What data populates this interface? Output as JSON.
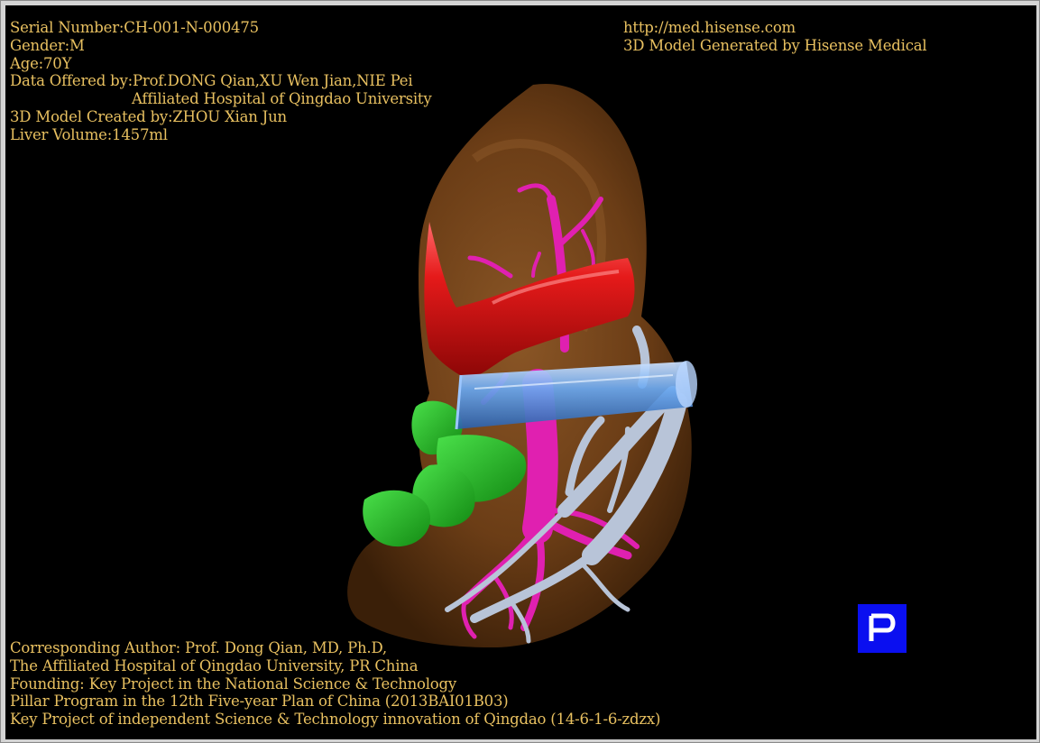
{
  "header_left": {
    "serial": "Serial Number:CH-001-N-000475",
    "gender": "Gender:M",
    "age": "Age:70Y",
    "data_offered": "Data Offered by:Prof.DONG Qian,XU Wen Jian,NIE Pei",
    "hospital": "Affiliated Hospital of Qingdao University",
    "created_by": "3D Model Created by:ZHOU Xian Jun",
    "liver_volume": "Liver Volume:1457ml"
  },
  "header_right": {
    "url": "http://med.hisense.com",
    "generated": "3D Model Generated by Hisense Medical"
  },
  "footer": {
    "author": "Corresponding Author: Prof. Dong Qian, MD, Ph.D,",
    "affiliation": "The Affiliated Hospital of Qingdao University, PR China",
    "founding": "Founding: Key Project in the National Science & Technology",
    "pillar": "Pillar Program in the 12th Five-year Plan of China (2013BAI01B03)",
    "key_project": "Key Project of independent Science & Technology innovation of Qingdao (14-6-1-6-zdzx)"
  },
  "colors": {
    "text": "#e8c060",
    "liver": "#6b3d16",
    "inferior_vena_cava": "#e01818",
    "portal_vein": "#e020b0",
    "hepatic_vein": "#b8c4d8",
    "gallbladder": "#22c022",
    "cylinder": "#6aa8f0",
    "view_marker": "#0a0ff0"
  },
  "icons": {
    "view_marker": "posterior-view-icon"
  }
}
